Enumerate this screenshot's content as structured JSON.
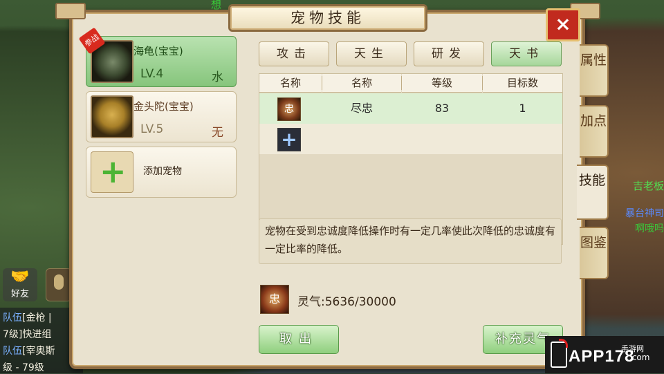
{
  "window": {
    "title": "宠物技能",
    "close_icon": "×"
  },
  "background": {
    "top_text": "想",
    "friend_label": "好友",
    "right_texts": [
      "吉老板",
      "暴台神司",
      "啊哦吗"
    ],
    "chat": [
      {
        "tag": "队伍",
        "text": "[金枪 |"
      },
      {
        "tag": "",
        "text": "7级]快进组"
      },
      {
        "tag": "队伍",
        "text": "[宰奥斯"
      },
      {
        "tag": "",
        "text": "级 - 79级"
      }
    ]
  },
  "pets": [
    {
      "name": "海龟(宝宝)",
      "level": "LV.4",
      "element": "水",
      "active": true,
      "badge": "参战"
    },
    {
      "name": "金头陀(宝宝)",
      "level": "LV.5",
      "element": "无",
      "active": false
    }
  ],
  "add_pet": {
    "label": "添加宠物",
    "icon": "+"
  },
  "tabs": [
    {
      "label": "攻击",
      "selected": false
    },
    {
      "label": "天生",
      "selected": false
    },
    {
      "label": "研发",
      "selected": false
    },
    {
      "label": "天书",
      "selected": true
    }
  ],
  "table": {
    "headers": [
      "名称",
      "名称",
      "等级",
      "目标数"
    ],
    "rows": [
      {
        "icon_text": "忠",
        "name": "尽忠",
        "level": "83",
        "targets": "1"
      }
    ],
    "add_icon": "+"
  },
  "description": "宠物在受到忠诚度降低操作时有一定几率使此次降低的忠诚度有一定比率的降低。",
  "aura": {
    "icon_text": "忠",
    "text": "灵气:5636/30000"
  },
  "buttons": {
    "take_out": "取出",
    "refill": "补充灵气"
  },
  "side_tabs": [
    {
      "label": "属性",
      "selected": false
    },
    {
      "label": "加点",
      "selected": false
    },
    {
      "label": "技能",
      "selected": true
    },
    {
      "label": "图鉴",
      "selected": false
    }
  ],
  "watermark": {
    "main": "APP178",
    "sub1": "手游网",
    "sub2": ".com"
  },
  "colors": {
    "accent_green": "#8fcf7e",
    "close_red": "#c12a1e",
    "frame_brown": "#8c6a42"
  }
}
